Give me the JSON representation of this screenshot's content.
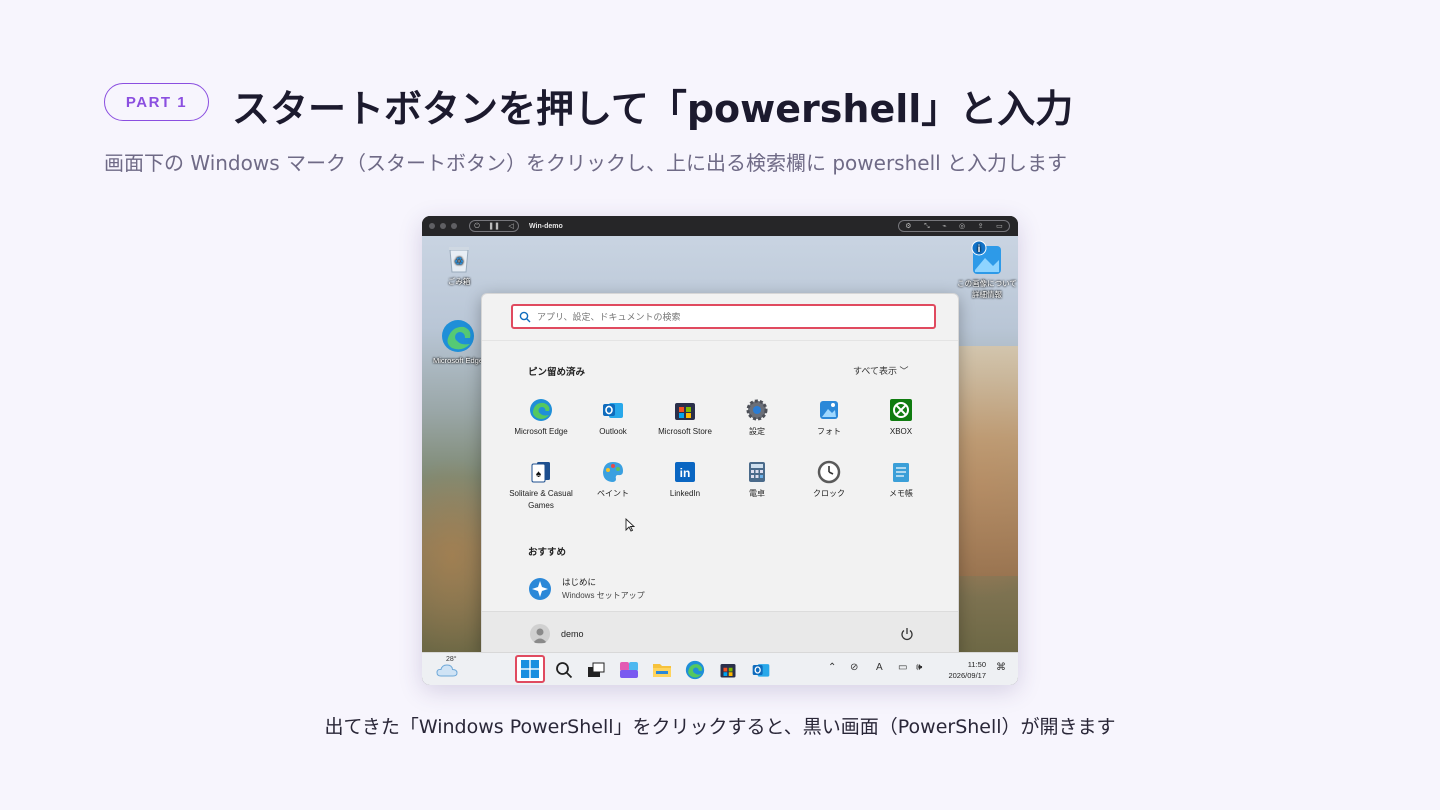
{
  "header": {
    "badge": "PART 1",
    "title": "スタートボタンを押して「powershell」と入力",
    "subtitle": "画面下の Windows マーク（スタートボタン）をクリックし、上に出る検索欄に powershell と入力します"
  },
  "caption": "出てきた「Windows PowerShell」をクリックすると、黒い画面（PowerShell）が開きます",
  "vm": {
    "name": "Win-demo",
    "desktop_icons": {
      "recycle_bin": "ごみ箱",
      "edge": "Microsoft Edge",
      "learn_more_line1": "この画像について",
      "learn_more_line2": "詳細情報"
    },
    "start_menu": {
      "search_placeholder": "アプリ、設定、ドキュメントの検索",
      "pinned_title": "ピン留め済み",
      "show_all": "すべて表示 ﹀",
      "pinned_apps": [
        {
          "label": "Microsoft Edge",
          "icon": "edge-icon",
          "color": "#1f8fd8"
        },
        {
          "label": "Outlook",
          "icon": "outlook-icon",
          "color": "#0f6cbd"
        },
        {
          "label": "Microsoft Store",
          "icon": "store-icon",
          "color": "#2a2f4a"
        },
        {
          "label": "設定",
          "icon": "settings-icon",
          "color": "#6b6f78"
        },
        {
          "label": "フォト",
          "icon": "photos-icon",
          "color": "#2b88d8"
        },
        {
          "label": "XBOX",
          "icon": "xbox-icon",
          "color": "#107c10"
        },
        {
          "label": "Solitaire & Casual Games",
          "icon": "solitaire-icon",
          "color": "#1d4f8f"
        },
        {
          "label": "ペイント",
          "icon": "paint-icon",
          "color": "#3aa0e0"
        },
        {
          "label": "LinkedIn",
          "icon": "linkedin-icon",
          "color": "#0a66c2"
        },
        {
          "label": "電卓",
          "icon": "calculator-icon",
          "color": "#4a6a8a"
        },
        {
          "label": "クロック",
          "icon": "clock-icon",
          "color": "#5a5a5a"
        },
        {
          "label": "メモ帳",
          "icon": "notepad-icon",
          "color": "#3b9fd8"
        }
      ],
      "recommended_title": "おすすめ",
      "recommended": [
        {
          "title": "はじめに",
          "subtitle": "Windows セットアップ"
        }
      ],
      "user_name": "demo"
    },
    "taskbar": {
      "weather": "28°",
      "time": "11:50",
      "date": "2026/09/17",
      "ime": "A"
    }
  }
}
